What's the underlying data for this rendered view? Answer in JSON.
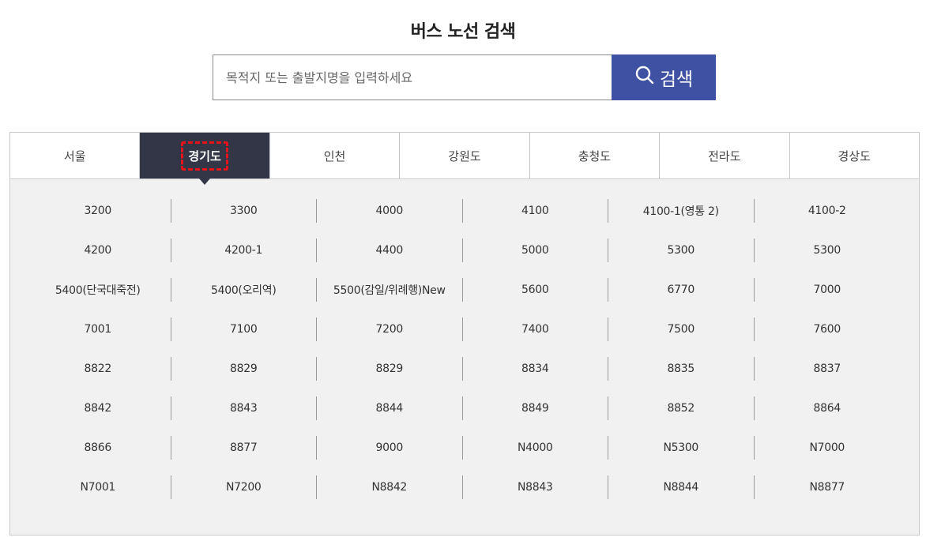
{
  "header": {
    "title": "버스 노선 검색"
  },
  "search": {
    "placeholder": "목적지 또는 출발지명을 입력하세요",
    "button_label": "검색",
    "button_color": "#3f51a3"
  },
  "tabs": [
    {
      "label": "서울",
      "active": false
    },
    {
      "label": "경기도",
      "active": true
    },
    {
      "label": "인천",
      "active": false
    },
    {
      "label": "강원도",
      "active": false
    },
    {
      "label": "충청도",
      "active": false
    },
    {
      "label": "전라도",
      "active": false
    },
    {
      "label": "경상도",
      "active": false
    }
  ],
  "routes": [
    "3200",
    "3300",
    "4000",
    "4100",
    "4100-1(영통 2)",
    "4100-2",
    "4200",
    "4200-1",
    "4400",
    "5000",
    "5300",
    "5300",
    "5400(단국대죽전)",
    "5400(오리역)",
    "5500(감일/위례행)New",
    "5600",
    "6770",
    "7000",
    "7001",
    "7100",
    "7200",
    "7400",
    "7500",
    "7600",
    "8822",
    "8829",
    "8829",
    "8834",
    "8835",
    "8837",
    "8842",
    "8843",
    "8844",
    "8849",
    "8852",
    "8864",
    "8866",
    "8877",
    "9000",
    "N4000",
    "N5300",
    "N7000",
    "N7001",
    "N7200",
    "N8842",
    "N8843",
    "N8844",
    "N8877"
  ],
  "colors": {
    "active_tab_bg": "#323646",
    "highlight_dashed": "#e8121a",
    "panel_bg": "#f1f1f1"
  }
}
